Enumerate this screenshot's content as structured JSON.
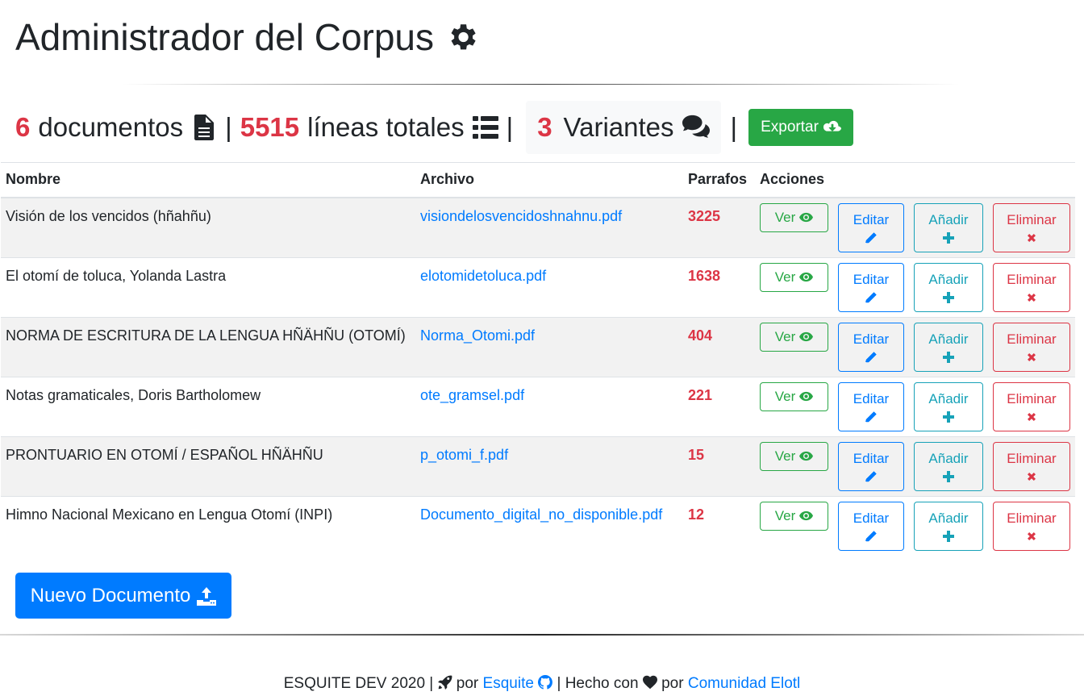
{
  "header": {
    "title": "Administrador del Corpus",
    "title_icon": "gear-icon"
  },
  "stats": {
    "documents_count": "6",
    "documents_label": "documentos",
    "documents_icon": "file-text-icon",
    "separator": "|",
    "lines_count": "5515",
    "lines_label": "líneas totales",
    "lines_icon": "list-icon",
    "variants_count": "3",
    "variants_label": "Variantes",
    "variants_icon": "comments-icon",
    "export_label": "Exportar",
    "export_icon": "cloud-download-icon"
  },
  "table": {
    "headers": {
      "name": "Nombre",
      "file": "Archivo",
      "paragraphs": "Parrafos",
      "actions": "Acciones"
    },
    "rows": [
      {
        "name": "Visión de los vencidos (hñahñu)",
        "file": "visiondelosvencidoshnahnu.pdf",
        "paragraphs": "3225"
      },
      {
        "name": "El otomí de toluca, Yolanda Lastra",
        "file": "elotomidetoluca.pdf",
        "paragraphs": "1638"
      },
      {
        "name": "NORMA DE ESCRITURA DE LA LENGUA HÑÄHÑU (OTOMÍ)",
        "file": "Norma_Otomi.pdf",
        "paragraphs": "404"
      },
      {
        "name": "Notas gramaticales, Doris Bartholomew",
        "file": "ote_gramsel.pdf",
        "paragraphs": "221"
      },
      {
        "name": "PRONTUARIO EN OTOMÍ / ESPAÑOL HÑÄHÑU",
        "file": "p_otomi_f.pdf",
        "paragraphs": "15"
      },
      {
        "name": "Himno Nacional Mexicano en Lengua Otomí (INPI)",
        "file": "Documento_digital_no_disponible.pdf",
        "paragraphs": "12"
      }
    ],
    "actions": {
      "view": "Ver",
      "edit": "Editar",
      "add": "Añadir",
      "delete": "Eliminar"
    }
  },
  "new_document": {
    "label": "Nuevo Documento",
    "icon": "upload-icon"
  },
  "footer": {
    "text1": "ESQUITE DEV 2020 |",
    "by1": "por",
    "link1": "Esquite",
    "text2": "| Hecho con",
    "by2": "por",
    "link2": "Comunidad Elotl"
  },
  "colors": {
    "danger": "#dc3545",
    "primary": "#007bff",
    "success": "#28a745",
    "info": "#17a2b8"
  }
}
